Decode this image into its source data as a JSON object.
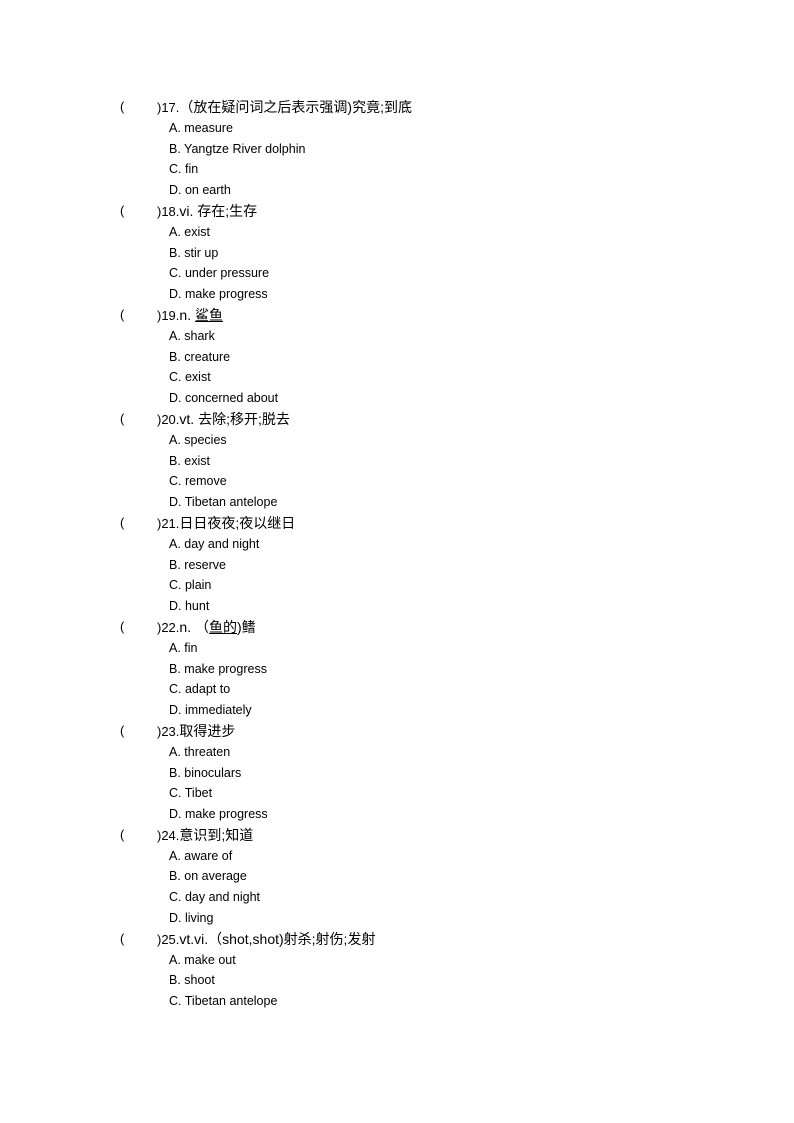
{
  "questions": [
    {
      "blank_open": "(",
      "number": ")17.",
      "stem_prefix": "（放在疑问词之后表示强调)究竟;到底",
      "stem_underlined": "",
      "stem_suffix": "",
      "options": [
        "A. measure",
        "B. Yangtze River dolphin",
        "C. fin",
        "D. on earth"
      ]
    },
    {
      "blank_open": "(",
      "number": ")18.",
      "stem_prefix": "vi.  存在;生存",
      "stem_underlined": "",
      "stem_suffix": "",
      "options": [
        "A. exist",
        "B. stir up",
        "C. under pressure",
        "D. make progress"
      ]
    },
    {
      "blank_open": "(",
      "number": ")19.",
      "stem_prefix": "n.  ",
      "stem_underlined": "鲨鱼",
      "stem_suffix": "",
      "options": [
        "A. shark",
        "B. creature",
        "C. exist",
        "D. concerned about"
      ]
    },
    {
      "blank_open": "(",
      "number": ")20.",
      "stem_prefix": "vt.  去除;移开;脱去",
      "stem_underlined": "",
      "stem_suffix": "",
      "options": [
        "A. species",
        "B. exist",
        "C. remove",
        "D. Tibetan antelope"
      ]
    },
    {
      "blank_open": "(",
      "number": ")21.",
      "stem_prefix": "日日夜夜;夜以继日",
      "stem_underlined": "",
      "stem_suffix": "",
      "options": [
        "A. day and night",
        "B. reserve",
        "C. plain",
        "D. hunt"
      ]
    },
    {
      "blank_open": "(",
      "number": ")22.",
      "stem_prefix": "n.  （",
      "stem_underlined": "鱼的",
      "stem_suffix": ")鳍",
      "options": [
        "A. fin",
        "B. make progress",
        "C. adapt to",
        "D. immediately"
      ]
    },
    {
      "blank_open": "(",
      "number": ")23.",
      "stem_prefix": "取得进步",
      "stem_underlined": "",
      "stem_suffix": "",
      "options": [
        "A. threaten",
        "B. binoculars",
        "C. Tibet",
        "D. make progress"
      ]
    },
    {
      "blank_open": "(",
      "number": ")24.",
      "stem_prefix": "意识到;知道",
      "stem_underlined": "",
      "stem_suffix": "",
      "options": [
        "A. aware of",
        "B. on average",
        "C. day and night",
        "D. living"
      ]
    },
    {
      "blank_open": "(",
      "number": ")25.",
      "stem_prefix": "vt.vi.（shot,shot)射杀;射伤;发射",
      "stem_underlined": "",
      "stem_suffix": "",
      "options": [
        "A. make out",
        "B. shoot",
        "C. Tibetan antelope"
      ]
    }
  ]
}
